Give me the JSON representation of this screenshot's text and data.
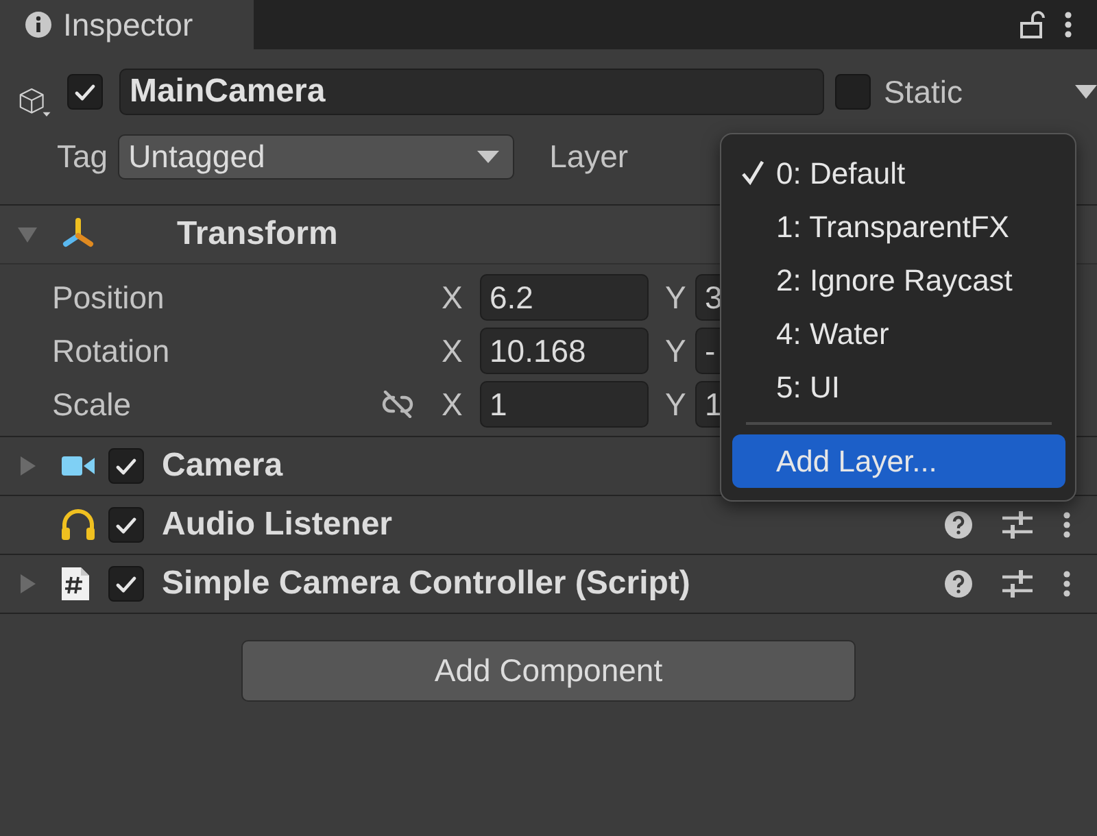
{
  "tab": {
    "label": "Inspector",
    "selected": true
  },
  "object": {
    "active": true,
    "name": "MainCamera",
    "static": false,
    "static_label": "Static",
    "tag_label": "Tag",
    "tag": "Untagged",
    "layer_label": "Layer"
  },
  "transform": {
    "title": "Transform",
    "expanded": true,
    "rows": [
      {
        "kind": "vector",
        "label": "Position",
        "fields": [
          {
            "axis": "X",
            "value": "6.2"
          },
          {
            "axis": "Y",
            "value": "3"
          }
        ]
      },
      {
        "kind": "vector",
        "label": "Rotation",
        "fields": [
          {
            "axis": "X",
            "value": "10.168"
          },
          {
            "axis": "Y",
            "value": "-"
          }
        ]
      },
      {
        "kind": "scale",
        "label": "Scale",
        "fields": [
          {
            "axis": "X",
            "value": "1"
          },
          {
            "axis": "Y",
            "value": "1"
          }
        ]
      }
    ]
  },
  "components": [
    {
      "kind": "camera",
      "name": "Camera",
      "enabled": true,
      "foldout": true,
      "tools": false
    },
    {
      "kind": "audio",
      "name": "Audio Listener",
      "enabled": true,
      "foldout": false,
      "tools": true
    },
    {
      "kind": "script",
      "name": "Simple Camera Controller (Script)",
      "enabled": true,
      "foldout": true,
      "tools": true
    }
  ],
  "add_button": "Add Component",
  "layer_menu": [
    {
      "kind": "layer",
      "label": "0: Default",
      "checked": true,
      "selected": false
    },
    {
      "kind": "layer",
      "label": "1: TransparentFX",
      "checked": false,
      "selected": false
    },
    {
      "kind": "layer",
      "label": "2: Ignore Raycast",
      "checked": false,
      "selected": false
    },
    {
      "kind": "layer",
      "label": "4: Water",
      "checked": false,
      "selected": false
    },
    {
      "kind": "layer",
      "label": "5: UI",
      "checked": false,
      "selected": false
    },
    {
      "kind": "action",
      "label": "Add Layer...",
      "selected": true
    }
  ]
}
